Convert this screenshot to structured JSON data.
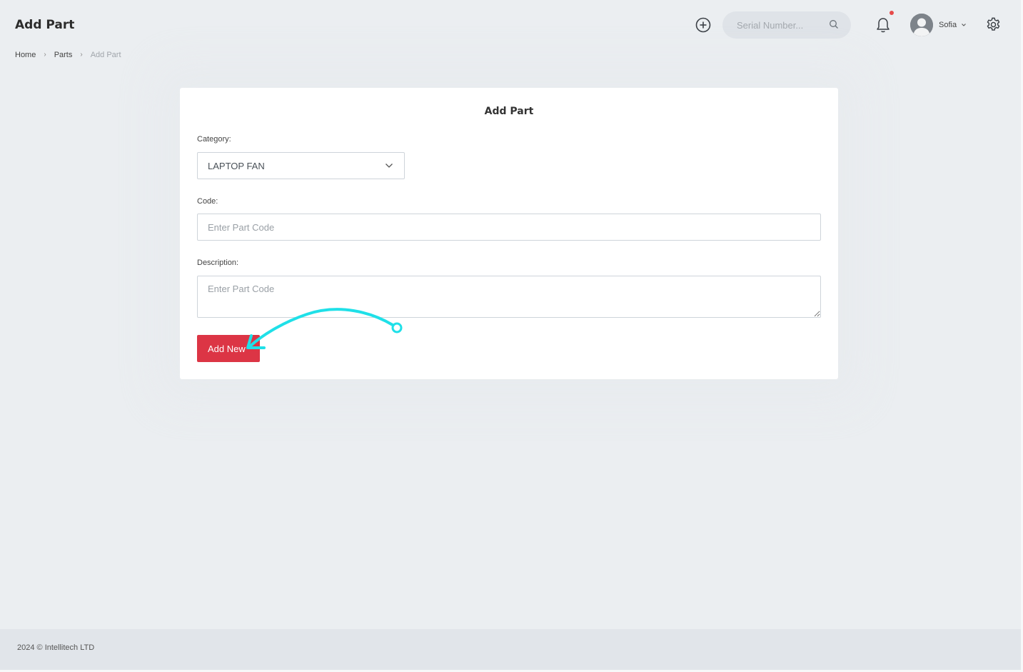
{
  "header": {
    "title": "Add Part",
    "search_placeholder": "Serial Number...",
    "user_name": "Sofia",
    "icons": [
      "plus-circle-icon",
      "search-icon",
      "bell-icon",
      "avatar",
      "chevron-down-icon",
      "gear-icon"
    ],
    "notification_dot_color": "#e64a4a"
  },
  "breadcrumb": {
    "items": [
      "Home",
      "Parts"
    ],
    "current": "Add Part"
  },
  "form": {
    "title": "Add Part",
    "category_label": "Category:",
    "category_value": "LAPTOP FAN",
    "code_label": "Code:",
    "code_placeholder": "Enter Part Code",
    "description_label": "Description:",
    "description_placeholder": "Enter Part Code",
    "submit_label": "Add New",
    "submit_color": "#dc3545"
  },
  "annotation": {
    "type": "curved-arrow",
    "color": "#1fe0e8",
    "points_to": "add-new-button"
  },
  "footer": {
    "text": "2024 © Intellitech LTD"
  }
}
